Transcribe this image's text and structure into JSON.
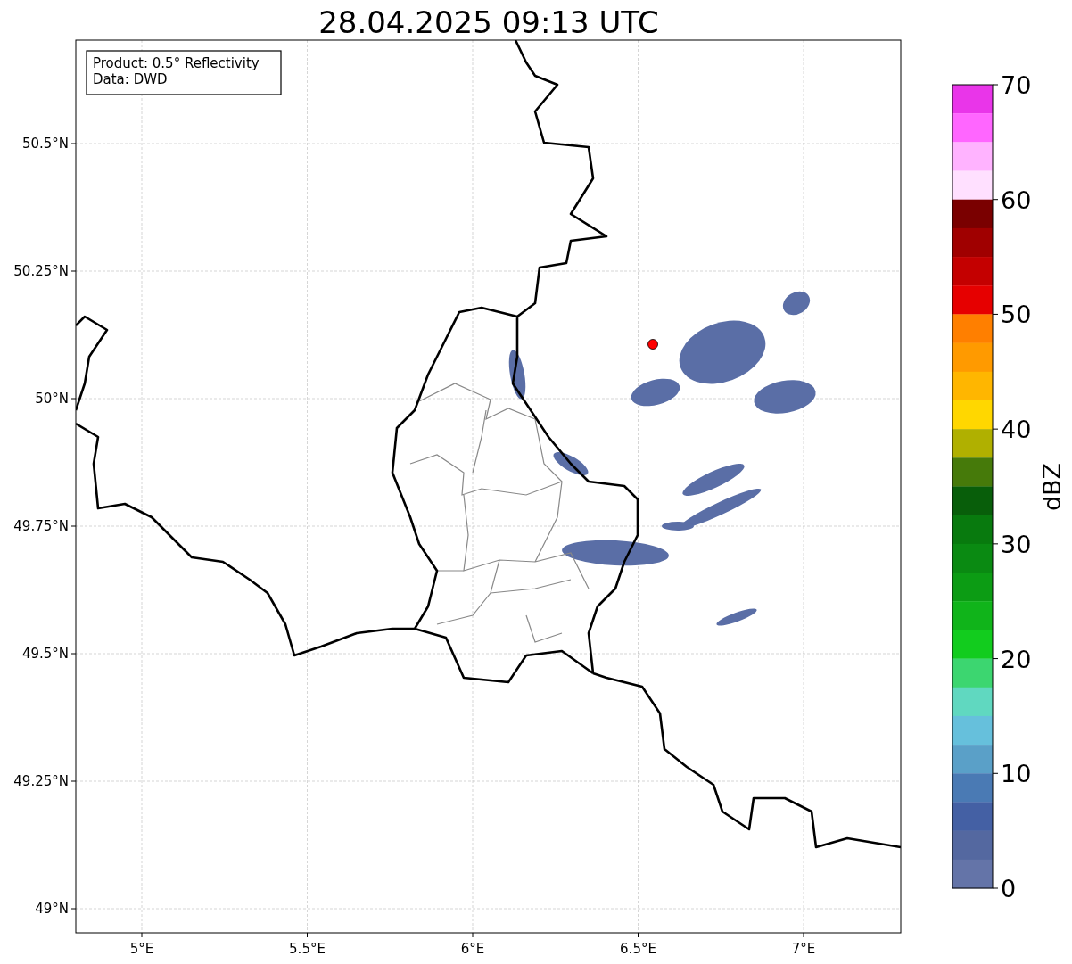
{
  "title": "28.04.2025 09:13 UTC",
  "info_box": {
    "lines": [
      "Product: 0.5° Reflectivity",
      "Data: DWD"
    ]
  },
  "y_ticks": [
    "50.5°N",
    "50.25°N",
    "50°N",
    "49.75°N",
    "49.5°N",
    "49.25°N",
    "49°N"
  ],
  "x_ticks": [
    "5°E",
    "5.5°E",
    "6°E",
    "6.5°E",
    "7°E"
  ],
  "colorbar": {
    "label": "dBZ",
    "ticks": [
      "70",
      "60",
      "50",
      "40",
      "30",
      "20",
      "10",
      "0"
    ],
    "bands": [
      {
        "color": "#e935e9"
      },
      {
        "color": "#ff66ff"
      },
      {
        "color": "#ffb3ff"
      },
      {
        "color": "#ffe0ff"
      },
      {
        "color": "#7a0000"
      },
      {
        "color": "#a00000"
      },
      {
        "color": "#c40000"
      },
      {
        "color": "#e60000"
      },
      {
        "color": "#ff7f00"
      },
      {
        "color": "#ff9a00"
      },
      {
        "color": "#ffb600"
      },
      {
        "color": "#ffd700"
      },
      {
        "color": "#b0b000"
      },
      {
        "color": "#467a0a"
      },
      {
        "color": "#085e0a"
      },
      {
        "color": "#087a0e"
      },
      {
        "color": "#0a8a12"
      },
      {
        "color": "#0c9c14"
      },
      {
        "color": "#10b41a"
      },
      {
        "color": "#12cc1e"
      },
      {
        "color": "#3cd670"
      },
      {
        "color": "#60d8c0"
      },
      {
        "color": "#66c0dc"
      },
      {
        "color": "#5aa0c8"
      },
      {
        "color": "#4a7ab4"
      },
      {
        "color": "#4460a4"
      },
      {
        "color": "#5468a0"
      },
      {
        "color": "#6474a8"
      }
    ]
  }
}
